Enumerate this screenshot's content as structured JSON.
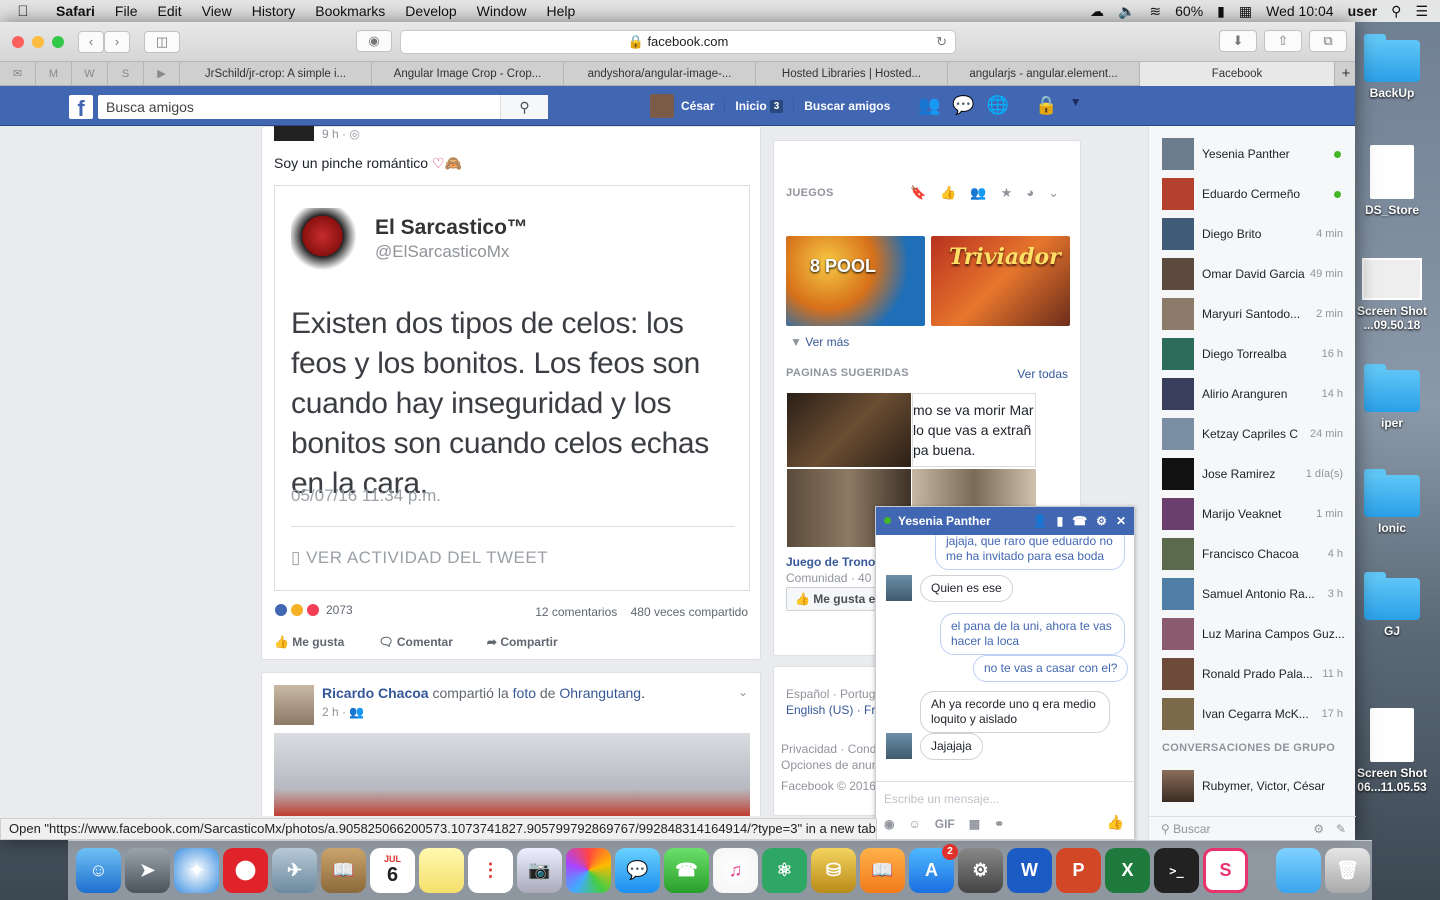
{
  "menubar": {
    "app": "Safari",
    "items": [
      "File",
      "Edit",
      "View",
      "History",
      "Bookmarks",
      "Develop",
      "Window",
      "Help"
    ],
    "battery": "60%",
    "clock": "Wed 10:04",
    "user": "user"
  },
  "browser": {
    "url": "facebook.com",
    "tabs": [
      "JrSchild/jr-crop: A simple i...",
      "Angular Image Crop - Crop...",
      "andyshora/angular-image-...",
      "Hosted Libraries  |  Hosted...",
      "angularjs - angular.element...",
      "Facebook"
    ],
    "pinned": [
      "M",
      "W",
      "S"
    ],
    "status_text": "Open \"https://www.facebook.com/SarcasticoMx/photos/a.905825066200573.1073741827.905799792869767/992848314164914/?type=3\" in a new tab"
  },
  "fb": {
    "search_placeholder": "Busca amigos",
    "nav": {
      "user": "César",
      "home": "Inicio",
      "home_count": "3",
      "find_friends": "Buscar amigos"
    }
  },
  "post1": {
    "time": "9 h · ",
    "text": "Soy un pinche romántico",
    "tweet": {
      "name": "El Sarcastico™",
      "handle": "@ElSarcasticoMx",
      "body": "Existen dos tipos de celos: los feos y los bonitos. Los feos son cuando hay inseguridad y los bonitos son cuando celos echas en la cara.",
      "date": "05/07/16 11:34 p.m.",
      "activity": "VER ACTIVIDAD DEL TWEET"
    },
    "reactions": "2073",
    "comments": "12 comentarios",
    "shares": "480 veces compartido",
    "actions": {
      "like": "Me gusta",
      "comment": "Comentar",
      "share": "Compartir"
    }
  },
  "post2": {
    "author": "Ricardo Chacoa",
    "verb": "compartió la",
    "object": "foto",
    "prep": "de",
    "source": "Ohrangutang",
    "time": "2 h · "
  },
  "right": {
    "games_title": "JUEGOS",
    "game1": "8 POOL",
    "game2": "Triviador",
    "see_more": "Ver más",
    "pages_title": "PAGINAS SUGERIDAS",
    "see_all": "Ver todas",
    "page_img_text": "mo se va morir Mar lo que vas a extrañ pa buena.",
    "page_name": "Juego de Trono",
    "page_meta": "Comunidad · 40",
    "page_like": "Me gusta es",
    "footer1": "Español · Portug",
    "footer2": "English (US) · Fr",
    "footer3": "Privacidad · Cond",
    "footer4": "Opciones de anun",
    "footer5": "Facebook © 2016"
  },
  "contacts": [
    {
      "name": "Yesenia Panther",
      "time": "",
      "online": true
    },
    {
      "name": "Eduardo Cermeño",
      "time": "",
      "online": true
    },
    {
      "name": "Diego Brito",
      "time": "4 min",
      "online": false
    },
    {
      "name": "Omar David Garcia",
      "time": "49 min",
      "online": false
    },
    {
      "name": "Maryuri Santodo...",
      "time": "2 min",
      "online": false
    },
    {
      "name": "Diego Torrealba",
      "time": "16 h",
      "online": false
    },
    {
      "name": "Alirio Aranguren",
      "time": "14 h",
      "online": false
    },
    {
      "name": "Ketzay Capriles C",
      "time": "24 min",
      "online": false
    },
    {
      "name": "Jose Ramirez",
      "time": "1 día(s)",
      "online": false
    },
    {
      "name": "Marijo Veaknet",
      "time": "1 min",
      "online": false
    },
    {
      "name": "Francisco Chacoa",
      "time": "4 h",
      "online": false
    },
    {
      "name": "Samuel Antonio Ra...",
      "time": "3 h",
      "online": false
    },
    {
      "name": "Luz Marina Campos Guz...",
      "time": "",
      "online": false
    },
    {
      "name": "Ronald Prado Pala...",
      "time": "11 h",
      "online": false
    },
    {
      "name": "Ivan Cegarra McK...",
      "time": "17 h",
      "online": false
    }
  ],
  "group_title": "CONVERSACIONES DE GRUPO",
  "group": "Rubymer, Victor, César",
  "chat_search": "Buscar",
  "chat": {
    "name": "Yesenia Panther",
    "msgs": [
      "jajaja, que raro que eduardo no me ha invitado para esa boda",
      "Quien es ese",
      "el pana de la uni, ahora te vas hacer la loca",
      "no te vas a casar con el?",
      "Ah ya recorde uno q era medio loquito y aislado",
      "Jajajaja"
    ],
    "placeholder": "Escribe un mensaje...",
    "gif": "GIF"
  },
  "desktop": [
    "BackUp",
    "DS_Store",
    "Screen Shot ...09.50.18",
    "iper",
    "Ionic",
    "GJ",
    "Screen Shot 06...11.05.53"
  ],
  "dock": {
    "calendar_month": "JUL",
    "calendar_day": "6",
    "appstore_badge": "2"
  }
}
